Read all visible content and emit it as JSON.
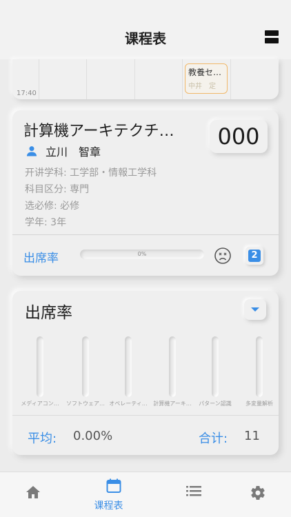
{
  "header": {
    "title": "课程表"
  },
  "timetable": {
    "time_label": "17:40",
    "class_block": {
      "name": "教養セ…",
      "teacher": "中井　定"
    }
  },
  "course": {
    "name": "計算機アーキテクチ…",
    "code": "000",
    "teacher": "立川　智章",
    "department": "开讲学科: 工学部・情報工学科",
    "category": "科目区分: 専門",
    "required": "选必修: 必修",
    "year": "学年: 3年",
    "attendance_label": "出席率",
    "attendance_percent_text": "0%",
    "attendance_fraction": 0,
    "badge": "2"
  },
  "attendance_chart": {
    "title": "出席率",
    "avg_label": "平均:",
    "avg_value": "0.00%",
    "total_label": "合计:",
    "total_value": "11"
  },
  "chart_data": {
    "type": "bar",
    "title": "出席率",
    "categories": [
      "メディアコン…",
      "ソフトウェア…",
      "オペレーティ…",
      "計算機アーキ…",
      "パターン認識",
      "多変量解析"
    ],
    "values": [
      0,
      0,
      0,
      0,
      0,
      0
    ],
    "ylim": [
      0,
      100
    ]
  },
  "tabbar": {
    "items": [
      {
        "icon": "home-icon",
        "label": ""
      },
      {
        "icon": "calendar-icon",
        "label": "课程表"
      },
      {
        "icon": "list-icon",
        "label": ""
      },
      {
        "icon": "gear-icon",
        "label": ""
      }
    ]
  },
  "colors": {
    "accent": "#3a8ee6",
    "class_border": "#f1b86a"
  }
}
